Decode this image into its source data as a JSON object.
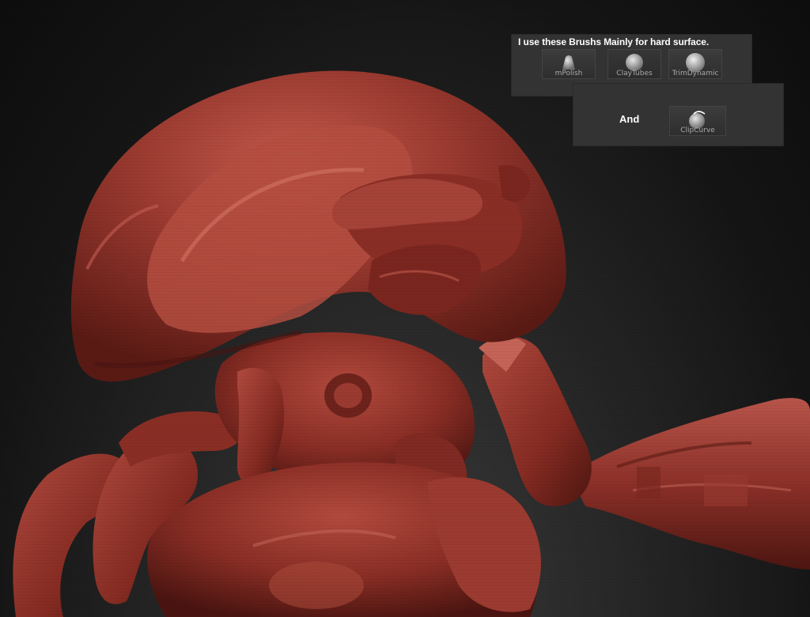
{
  "panel": {
    "caption": "I use  these Brushs Mainly for hard surface.",
    "and_label": "And",
    "brushes": [
      {
        "name": "mPolish",
        "icon": "mpolish-brush-icon"
      },
      {
        "name": "ClayTubes",
        "icon": "claytubes-brush-icon"
      },
      {
        "name": "TrimDynamic",
        "icon": "trimdynamic-brush-icon"
      }
    ],
    "extra_brush": {
      "name": "ClipCurve",
      "icon": "clipcurve-brush-icon"
    }
  },
  "colors": {
    "model_base": "#8a2e25",
    "model_highlight": "#c2574a",
    "model_shadow": "#4a1410",
    "panel_bg": "#333333"
  }
}
